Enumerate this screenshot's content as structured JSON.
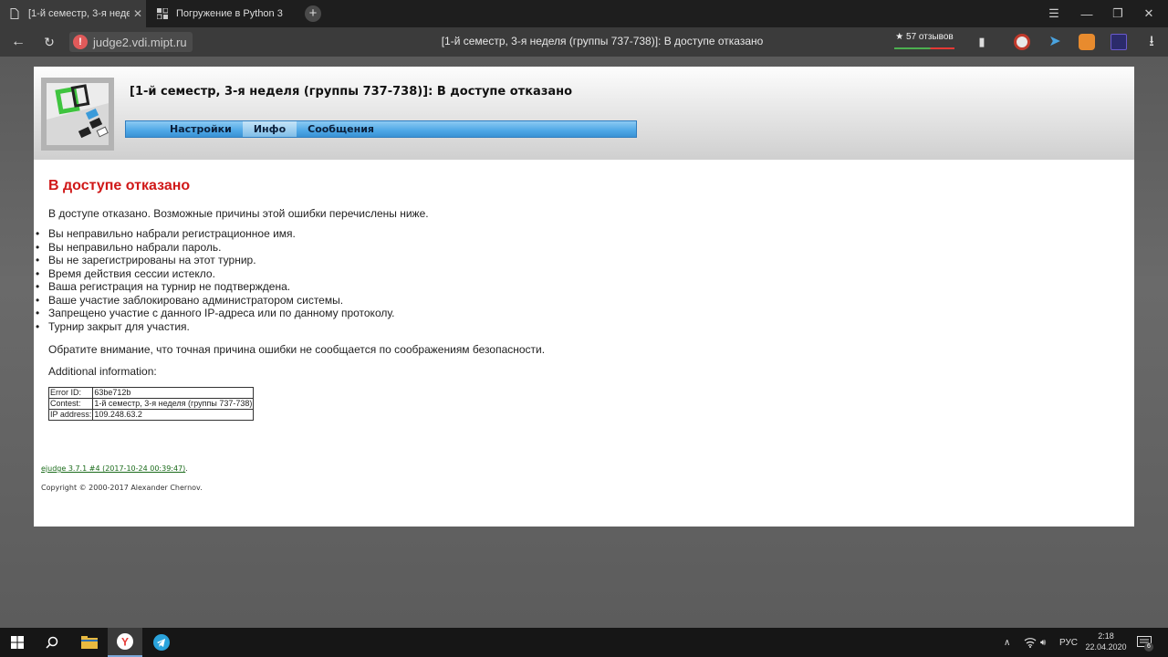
{
  "browser": {
    "tabs": [
      {
        "title": "[1-й семестр, 3-я недел",
        "active": true
      },
      {
        "title": "Погружение в Python 3",
        "active": false
      }
    ],
    "url": "judge2.vdi.mipt.ru",
    "page_title": "[1-й семестр, 3-я неделя (группы 737-738)]: В доступе отказано",
    "reviews": "★ 57 отзывов"
  },
  "header": {
    "title": "[1-й семестр, 3-я неделя (группы 737-738)]: В доступе отказано",
    "menu": [
      "Настройки",
      "Инфо",
      "Сообщения"
    ]
  },
  "content": {
    "heading": "В доступе отказано",
    "intro": "В доступе отказано. Возможные причины этой ошибки перечислены ниже.",
    "reasons": [
      "Вы неправильно набрали регистрационное имя.",
      "Вы неправильно набрали пароль.",
      "Вы не зарегистрированы на этот турнир.",
      "Время действия сессии истекло.",
      "Ваша регистрация на турнир не подтверждена.",
      "Ваше участие заблокировано администратором системы.",
      "Запрещено участие с данного IP-адреса или по данному протоколу.",
      "Турнир закрыт для участия."
    ],
    "note": "Обратите внимание, что точная причина ошибки не сообщается по соображениям безопасности.",
    "additional": "Additional information:",
    "info_table": [
      {
        "label": "Error ID:",
        "value": "63be712b"
      },
      {
        "label": "Contest:",
        "value": "1-й семестр, 3-я неделя (группы 737-738)"
      },
      {
        "label": "IP address:",
        "value": "109.248.63.2"
      }
    ]
  },
  "footer": {
    "version_link": "ejudge 3.7.1 #4 (2017-10-24 00:39:47)",
    "version_suffix": ".",
    "copyright": "Copyright © 2000-2017 Alexander Chernov."
  },
  "taskbar": {
    "lang": "РУС",
    "time": "2:18",
    "date": "22.04.2020",
    "notif_count": "6"
  }
}
